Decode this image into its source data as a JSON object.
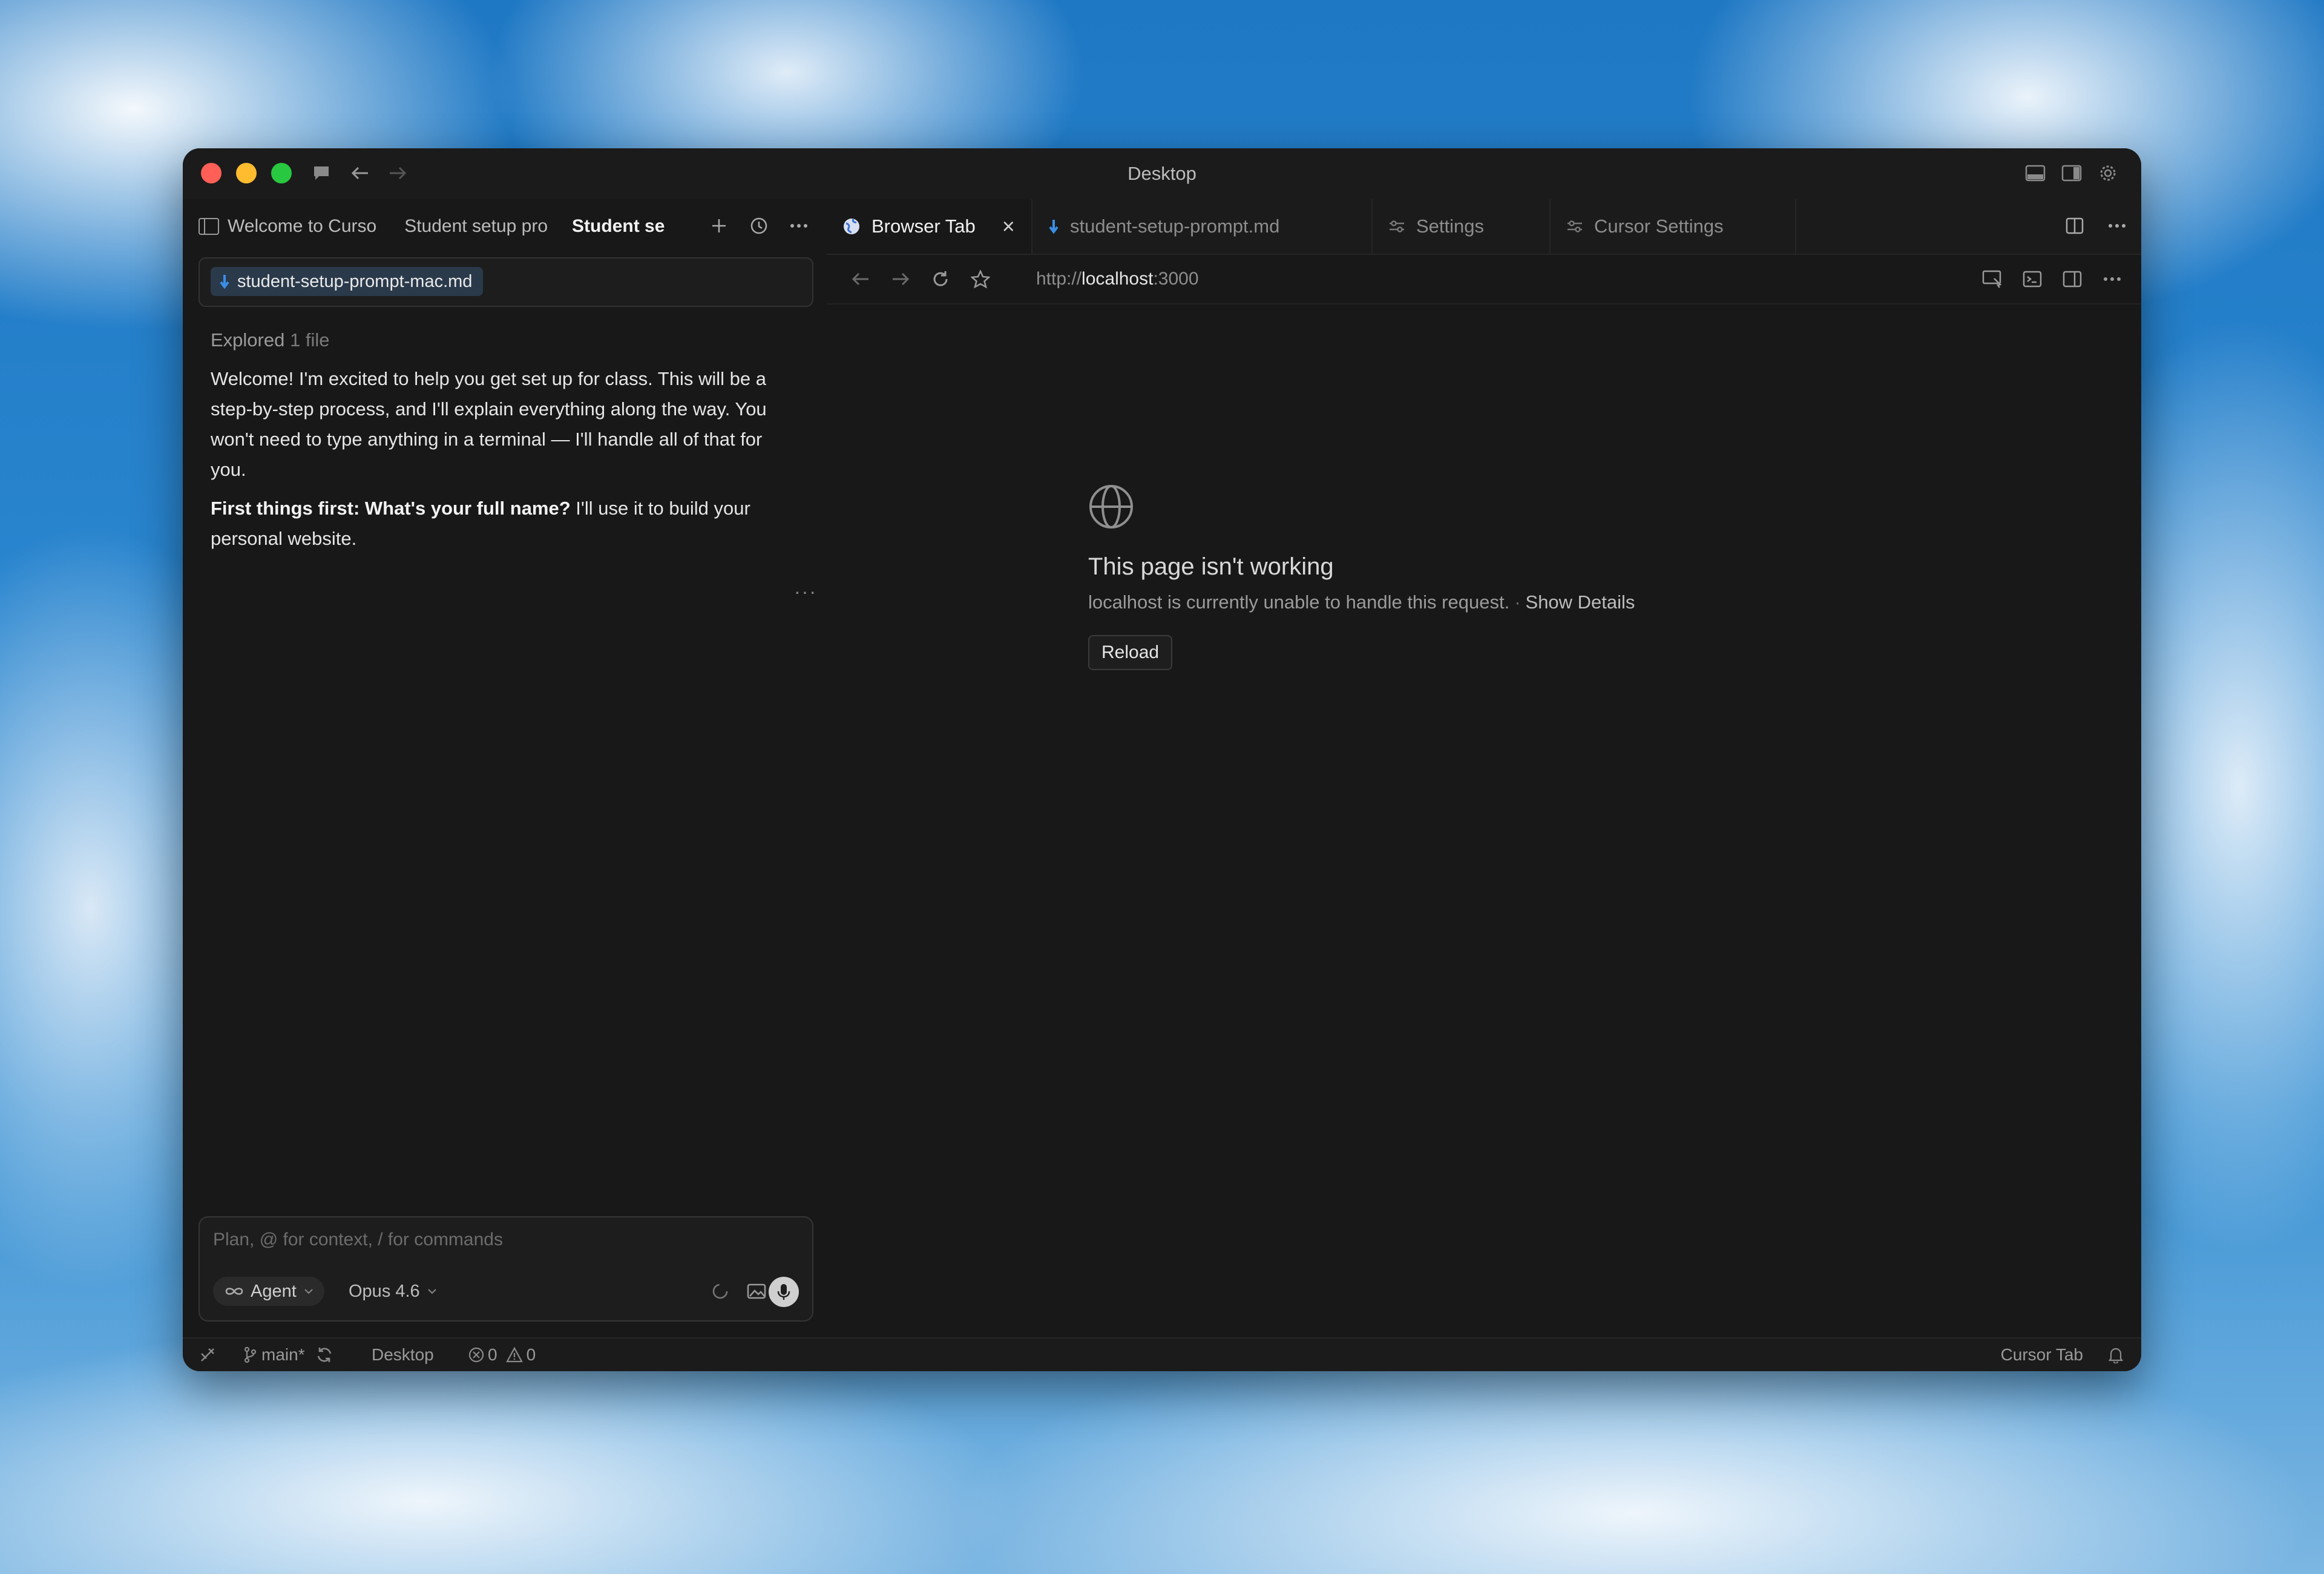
{
  "window": {
    "title": "Desktop"
  },
  "left_tabs": [
    {
      "label": "Welcome to Curso"
    },
    {
      "label": "Student setup pro"
    },
    {
      "label": "Student se"
    }
  ],
  "context": {
    "chip_label": "student-setup-prompt-mac.md"
  },
  "chat": {
    "explored_prefix": "Explored",
    "explored_count": "1 file",
    "welcome": "Welcome! I'm excited to help you get set up for class. This will be a step-by-step process, and I'll explain everything along the way. You won't need to type anything in a terminal — I'll handle all of that for you.",
    "question_bold": "First things first: What's your full name?",
    "question_rest": " I'll use it to build your personal website.",
    "more": "···"
  },
  "composer": {
    "placeholder": "Plan, @ for context, / for commands",
    "mode": "Agent",
    "model": "Opus 4.6"
  },
  "right_tabs": [
    {
      "label": "Browser Tab",
      "active": true
    },
    {
      "label": "student-setup-prompt.md"
    },
    {
      "label": "Settings"
    },
    {
      "label": "Cursor Settings"
    }
  ],
  "browser": {
    "url_prefix": "http://",
    "url_host": "localhost",
    "url_port": ":3000"
  },
  "error": {
    "title": "This page isn't working",
    "description": "localhost is currently unable to handle this request.",
    "separator": "·",
    "details_link": "Show Details",
    "reload_label": "Reload"
  },
  "status": {
    "branch": "main*",
    "folder": "Desktop",
    "errors": "0",
    "warnings": "0",
    "right_label": "Cursor Tab"
  },
  "colors": {
    "accent_blue": "#3a8ee6",
    "chip_bg": "#2a3a4b",
    "close": "#ff5f57",
    "minimize": "#febc2e",
    "maximize": "#28c840"
  }
}
